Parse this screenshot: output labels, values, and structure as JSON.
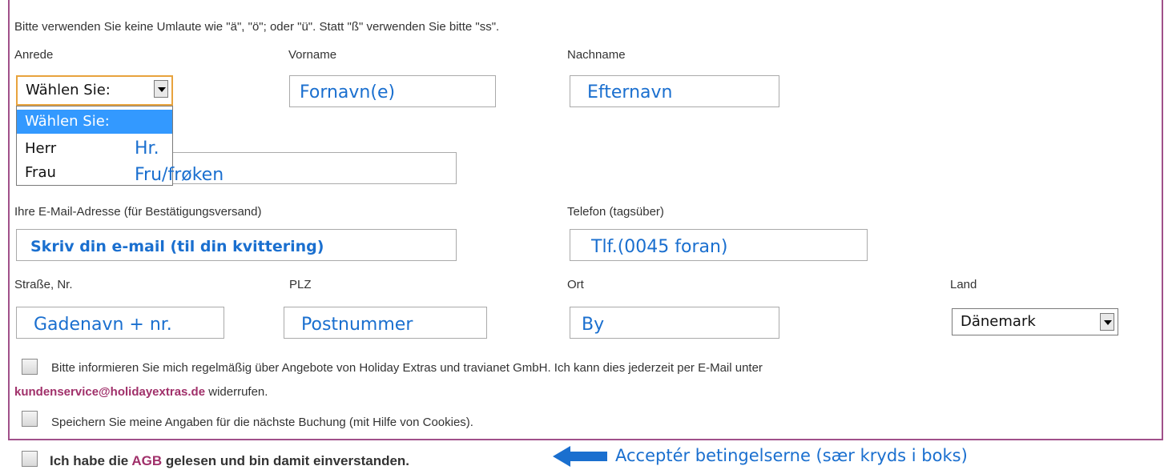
{
  "notice": "Bitte verwenden Sie keine Umlaute wie \"ä\", \"ö\"; oder \"ü\". Statt \"ß\" verwenden Sie bitte \"ss\".",
  "labels": {
    "anrede": "Anrede",
    "vorname": "Vorname",
    "nachname": "Nachname",
    "email": "Ihre E-Mail-Adresse (für Bestätigungsversand)",
    "telefon": "Telefon (tagsüber)",
    "strasse": "Straße, Nr.",
    "plz": "PLZ",
    "ort": "Ort",
    "land": "Land"
  },
  "anrede_select": {
    "value": "Wählen Sie:",
    "options": [
      "Wählen Sie:",
      "Herr",
      "Frau"
    ]
  },
  "hints": {
    "herr": "Hr.",
    "frau": "Fru/frøken",
    "vorname": "Fornavn(e)",
    "nachname": "Efternavn",
    "email": "Skriv din e-mail  (til din kvittering)",
    "telefon": "Tlf.(0045 foran)",
    "strasse": "Gadenavn + nr.",
    "plz": "Postnummer",
    "ort": "By",
    "accept": "Acceptér betingelserne (sær kryds i boks)"
  },
  "land_select": {
    "value": "Dänemark"
  },
  "checks": {
    "newsletter_text": "Bitte informieren Sie mich regelmäßig über Angebote von Holiday Extras und travianet GmbH. Ich kann dies jederzeit per E-Mail unter",
    "newsletter_link": "kundenservice@holidayextras.de",
    "newsletter_suffix": " widerrufen.",
    "cookies_text": "Speichern Sie meine Angaben für die nächste Buchung (mit Hilfe von Cookies).",
    "agb_prefix": "Ich habe die ",
    "agb_link": "AGB",
    "agb_suffix": " gelesen und bin damit einverstanden."
  },
  "colors": {
    "frame": "#a0508a",
    "hint": "#1a6fcf",
    "link": "#a0306a",
    "selected_option": "#3399ff",
    "focus_border": "#e8a33d"
  }
}
